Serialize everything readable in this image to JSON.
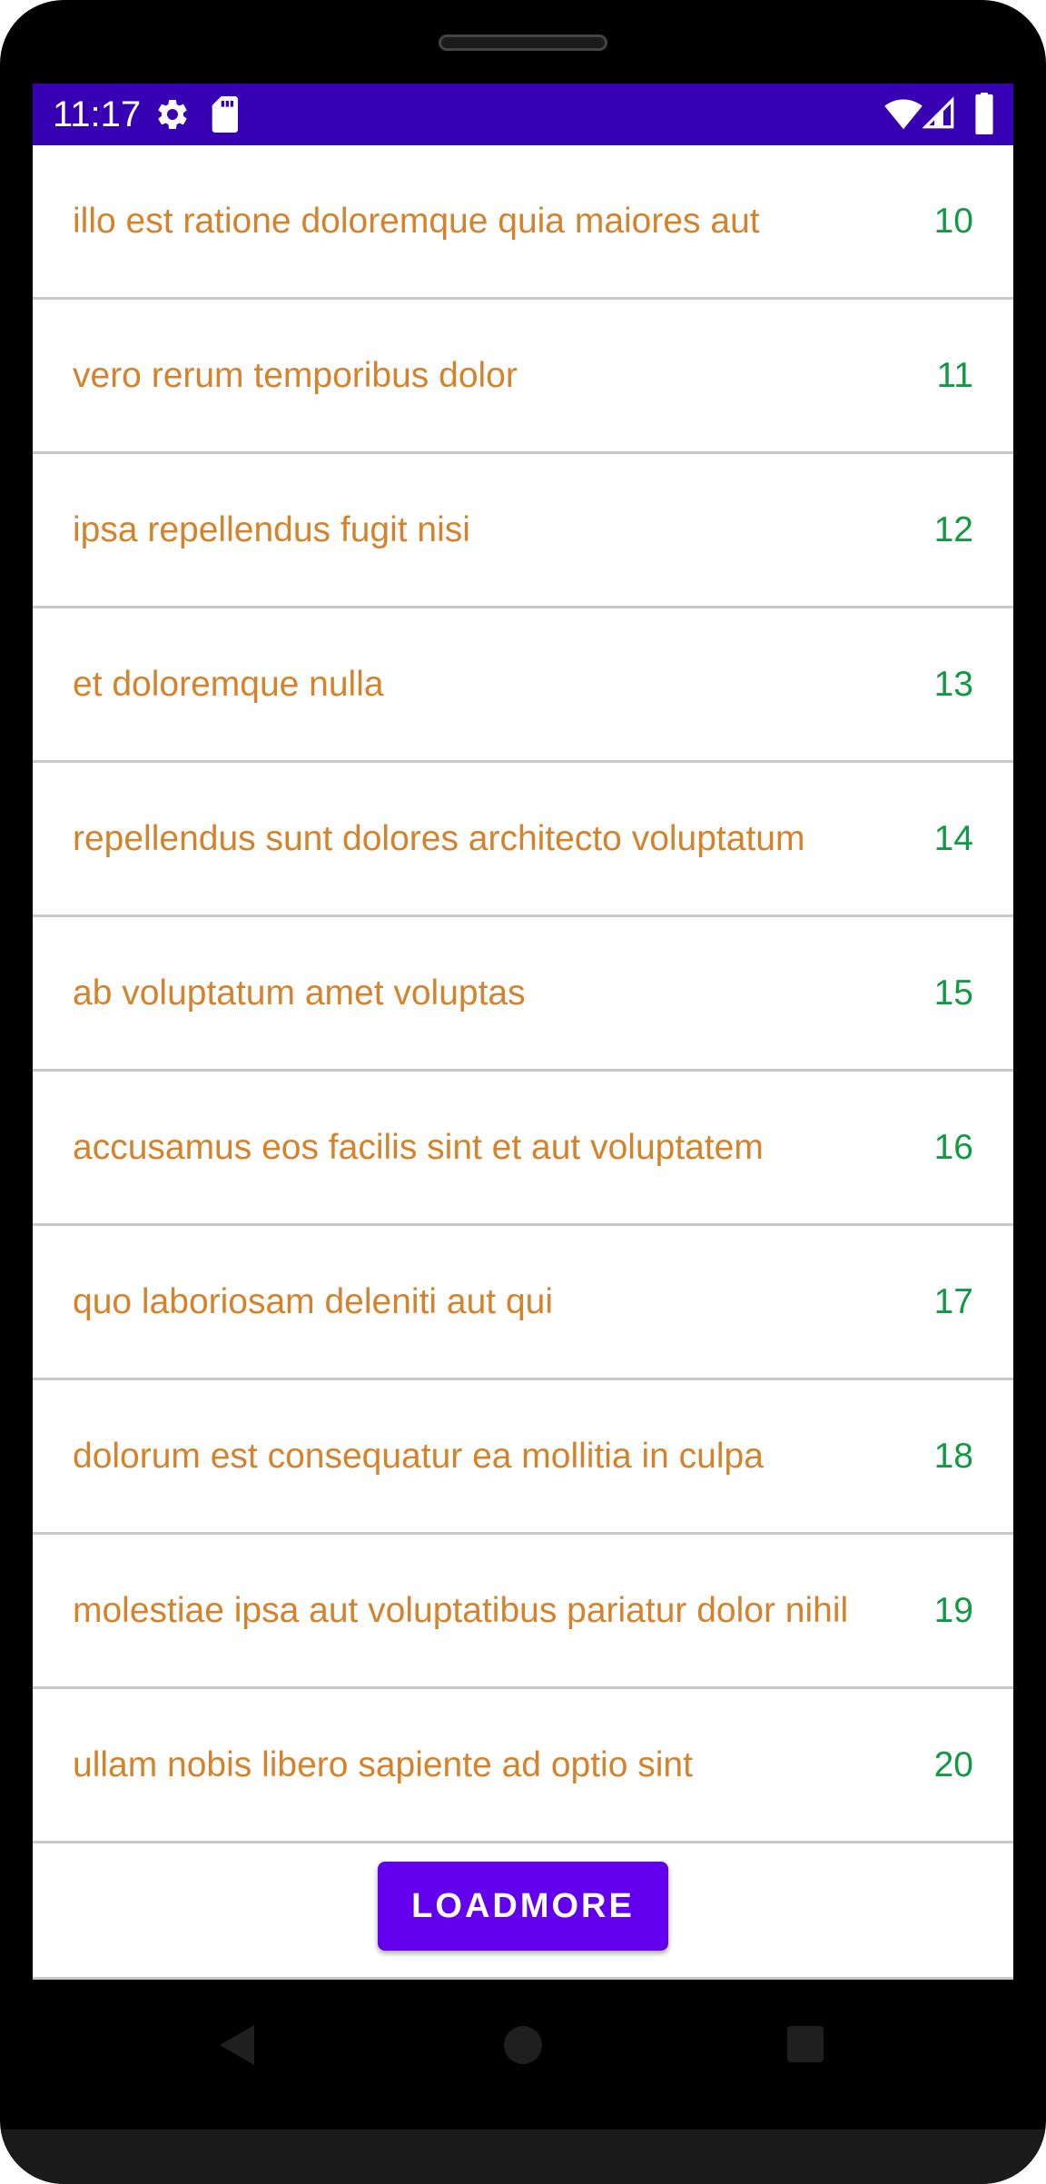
{
  "status_bar": {
    "time": "11:17",
    "background": "#3700b3",
    "left_icons": [
      "settings-icon",
      "sd-card-icon"
    ],
    "right_icons": [
      "wifi-icon",
      "signal-icon",
      "battery-icon"
    ]
  },
  "list": {
    "title_color": "#d4832c",
    "number_color": "#129944",
    "items": [
      {
        "title": "illo est ratione doloremque quia maiores aut",
        "number": "10"
      },
      {
        "title": "vero rerum temporibus dolor",
        "number": "11"
      },
      {
        "title": "ipsa repellendus fugit nisi",
        "number": "12"
      },
      {
        "title": "et doloremque nulla",
        "number": "13"
      },
      {
        "title": "repellendus sunt dolores architecto voluptatum",
        "number": "14"
      },
      {
        "title": "ab voluptatum amet voluptas",
        "number": "15"
      },
      {
        "title": "accusamus eos facilis sint et aut voluptatem",
        "number": "16"
      },
      {
        "title": "quo laboriosam deleniti aut qui",
        "number": "17"
      },
      {
        "title": "dolorum est consequatur ea mollitia in culpa",
        "number": "18"
      },
      {
        "title": "molestiae ipsa aut voluptatibus pariatur dolor nihil",
        "number": "19"
      },
      {
        "title": "ullam nobis libero sapiente ad optio sint",
        "number": "20"
      }
    ]
  },
  "load_more": {
    "label": "LOADMORE",
    "background": "#6200ee",
    "text_color": "#ffffff"
  },
  "nav_bar": {
    "icons": [
      "back-icon",
      "home-icon",
      "recents-icon"
    ]
  }
}
